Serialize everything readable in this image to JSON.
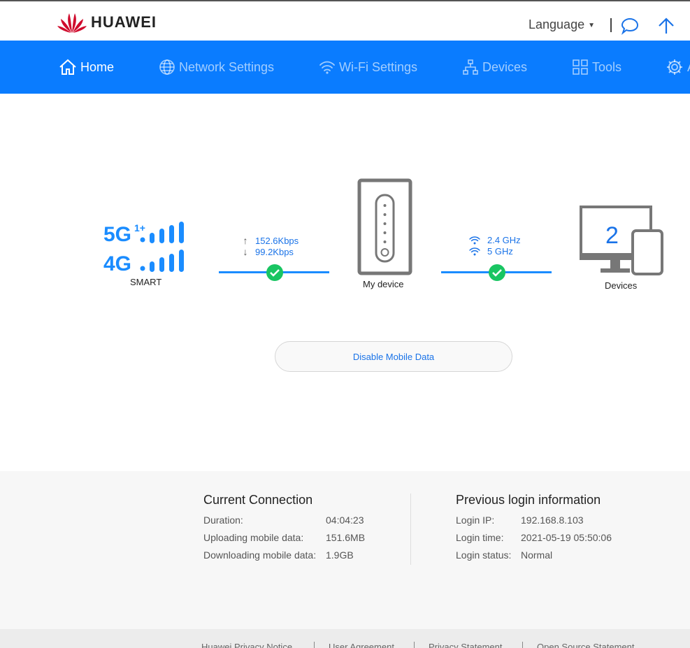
{
  "header": {
    "brand": "HUAWEI",
    "language_label": "Language",
    "icons": [
      "chat-icon",
      "arrow-up-icon"
    ]
  },
  "nav": {
    "items": [
      {
        "label": "Home",
        "icon": "home-icon"
      },
      {
        "label": "Network Settings",
        "icon": "globe-icon"
      },
      {
        "label": "Wi-Fi Settings",
        "icon": "wifi-icon"
      },
      {
        "label": "Devices",
        "icon": "network-tree-icon"
      },
      {
        "label": "Tools",
        "icon": "grid-icon"
      },
      {
        "label": "A",
        "icon": "gear-icon"
      }
    ],
    "active": "Home"
  },
  "status": {
    "network_top": "5G",
    "network_top_sup": "1+",
    "network_bottom": "4G",
    "network_mode": "SMART",
    "upload_rate": "152.6Kbps",
    "download_rate": "99.2Kbps",
    "device_label": "My device",
    "wifi_band_1": "2.4 GHz",
    "wifi_band_2": "5 GHz",
    "devices_count": "2",
    "devices_label": "Devices",
    "disable_button": "Disable Mobile Data"
  },
  "current_connection": {
    "title": "Current Connection",
    "rows": [
      {
        "label": "Duration:",
        "value": "04:04:23"
      },
      {
        "label": "Uploading mobile data:",
        "value": "151.6MB"
      },
      {
        "label": "Downloading mobile data:",
        "value": "1.9GB"
      }
    ]
  },
  "previous_login": {
    "title": "Previous login information",
    "rows": [
      {
        "label": "Login IP:",
        "value": "192.168.8.103"
      },
      {
        "label": "Login time:",
        "value": "2021-05-19 05:50:06"
      },
      {
        "label": "Login status:",
        "value": "Normal"
      }
    ]
  },
  "footer": {
    "links": [
      "Huawei Privacy Notice",
      "User Agreement",
      "Privacy Statement",
      "Open Source Statement"
    ]
  },
  "colors": {
    "nav_bg": "#0a7cff",
    "accent_blue": "#1a73e8",
    "check_green": "#19c562",
    "brand_red": "#cf0a2c"
  }
}
